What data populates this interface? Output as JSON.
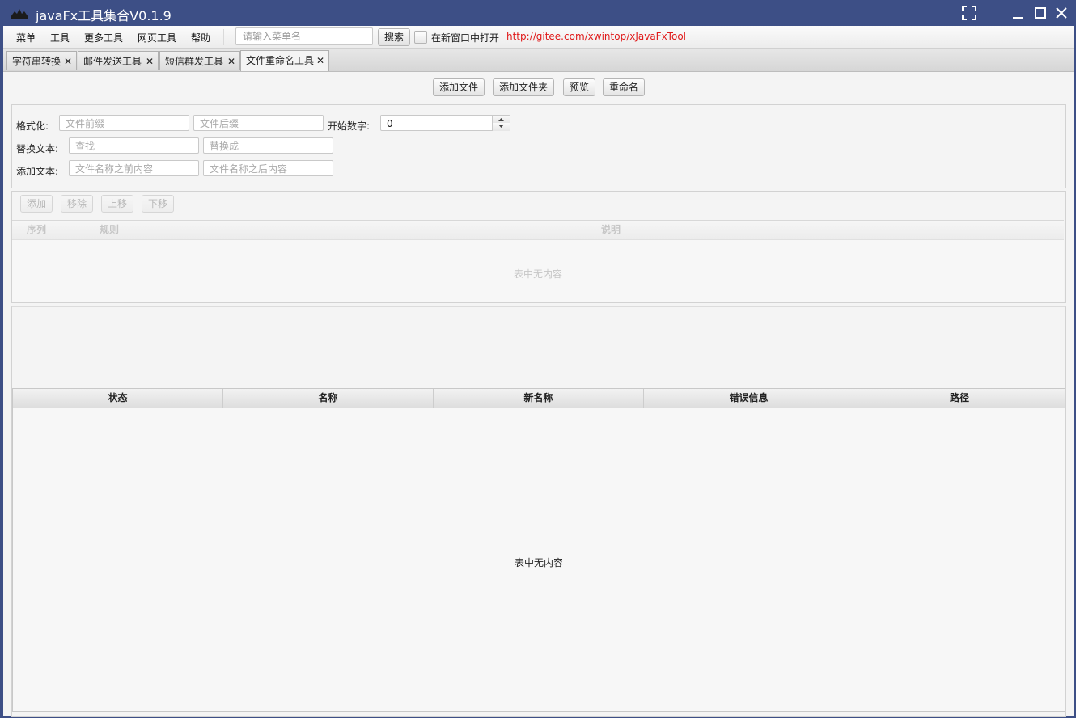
{
  "window": {
    "title": "javaFx工具集合V0.1.9"
  },
  "menubar": {
    "items": [
      {
        "label": "菜单"
      },
      {
        "label": "工具"
      },
      {
        "label": "更多工具"
      },
      {
        "label": "网页工具"
      },
      {
        "label": "帮助"
      }
    ],
    "search_placeholder": "请输入菜单名",
    "search_button": "搜索",
    "new_window_label": "在新窗口中打开",
    "link": "http://gitee.com/xwintop/xJavaFxTool"
  },
  "tabs": [
    {
      "label": "字符串转换",
      "close": "✕"
    },
    {
      "label": "邮件发送工具",
      "close": "✕"
    },
    {
      "label": "短信群发工具",
      "close": "✕"
    },
    {
      "label": "文件重命名工具",
      "close": "✕",
      "active": true
    }
  ],
  "toolbar": {
    "add_file": "添加文件",
    "add_folder": "添加文件夹",
    "preview": "预览",
    "rename": "重命名"
  },
  "form": {
    "format_label": "格式化:",
    "prefix_placeholder": "文件前缀",
    "suffix_placeholder": "文件后缀",
    "start_number_label": "开始数字:",
    "start_number_value": "0",
    "replace_label": "替换文本:",
    "find_placeholder": "查找",
    "replace_with_placeholder": "替换成",
    "add_text_label": "添加文本:",
    "before_placeholder": "文件名称之前内容",
    "after_placeholder": "文件名称之后内容"
  },
  "rules": {
    "buttons": [
      "添加",
      "移除",
      "上移",
      "下移"
    ],
    "columns": [
      "序列",
      "规则",
      "说明"
    ],
    "empty_text": "表中无内容"
  },
  "files_table": {
    "columns": [
      "状态",
      "名称",
      "新名称",
      "错误信息",
      "路径"
    ],
    "empty_text": "表中无内容"
  }
}
